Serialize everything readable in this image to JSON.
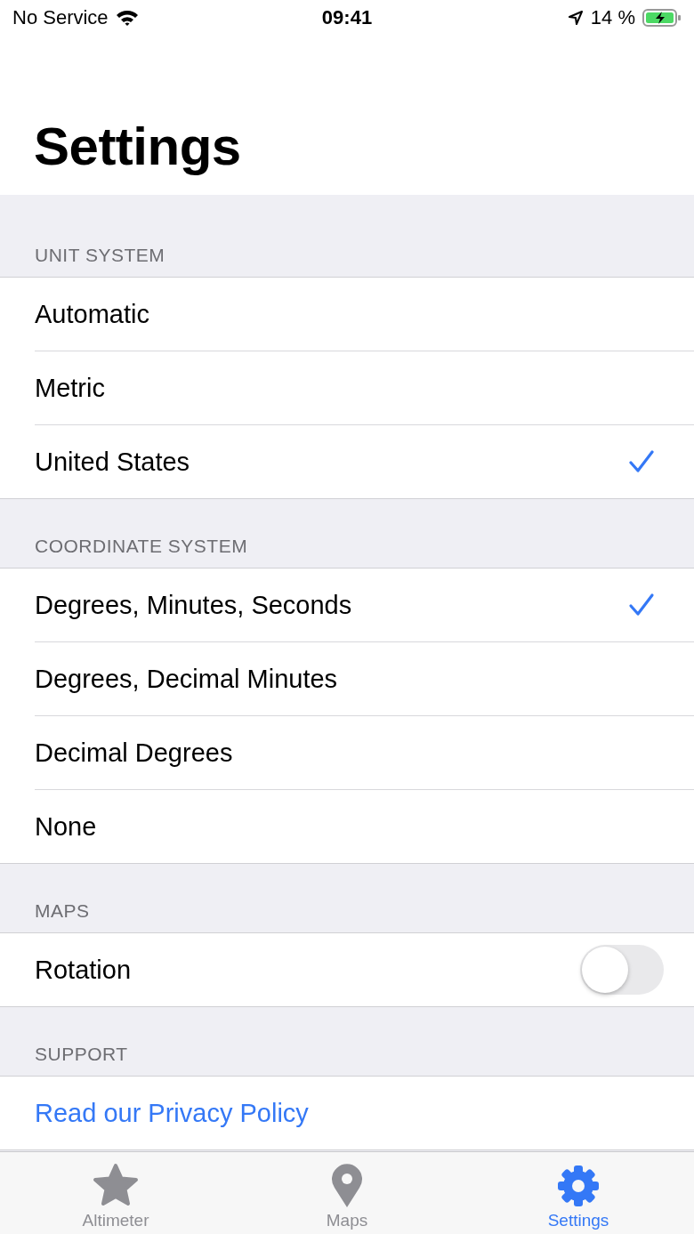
{
  "status_bar": {
    "carrier": "No Service",
    "time": "09:41",
    "battery": "14 %"
  },
  "title": "Settings",
  "sections": [
    {
      "header": "UNIT SYSTEM",
      "rows": [
        {
          "kind": "choice",
          "label": "Automatic",
          "selected": false
        },
        {
          "kind": "choice",
          "label": "Metric",
          "selected": false
        },
        {
          "kind": "choice",
          "label": "United States",
          "selected": true
        }
      ]
    },
    {
      "header": "COORDINATE SYSTEM",
      "rows": [
        {
          "kind": "choice",
          "label": "Degrees, Minutes, Seconds",
          "selected": true
        },
        {
          "kind": "choice",
          "label": "Degrees, Decimal Minutes",
          "selected": false
        },
        {
          "kind": "choice",
          "label": "Decimal Degrees",
          "selected": false
        },
        {
          "kind": "choice",
          "label": "None",
          "selected": false
        }
      ]
    },
    {
      "header": "MAPS",
      "rows": [
        {
          "kind": "toggle",
          "label": "Rotation",
          "on": false
        }
      ]
    },
    {
      "header": "SUPPORT",
      "rows": [
        {
          "kind": "link",
          "label": "Read our Privacy Policy"
        }
      ]
    }
  ],
  "tabs": [
    {
      "kind": "star",
      "label": "Altimeter",
      "selected": false
    },
    {
      "kind": "pin",
      "label": "Maps",
      "selected": false
    },
    {
      "kind": "gear",
      "label": "Settings",
      "selected": true
    }
  ]
}
